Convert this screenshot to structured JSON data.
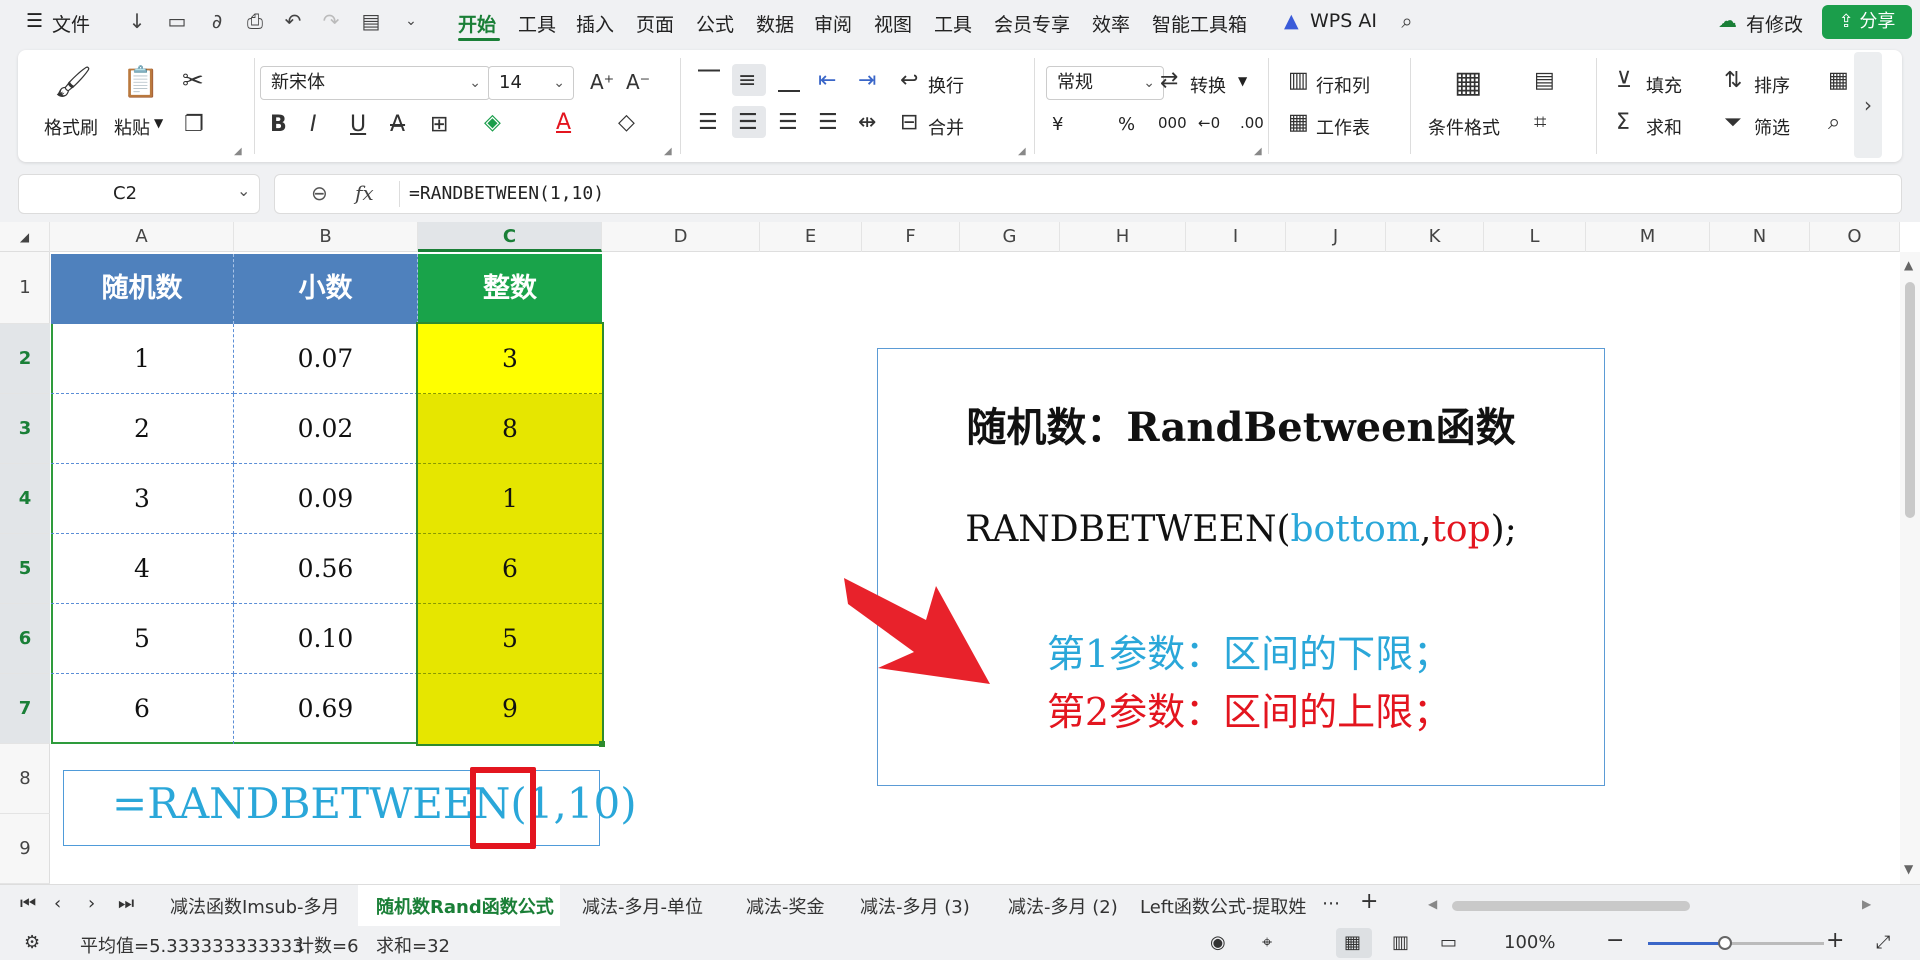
{
  "menubar": {
    "file": "文件",
    "tabs": [
      "开始",
      "工具",
      "插入",
      "页面",
      "公式",
      "数据",
      "审阅",
      "视图",
      "工具",
      "会员专享",
      "效率",
      "智能工具箱"
    ],
    "wps_ai": "WPS AI",
    "status_saved": "有修改",
    "share": "分享"
  },
  "ribbon": {
    "format_painter": "格式刷",
    "paste": "粘贴",
    "font_name": "新宋体",
    "font_size": "14",
    "wrap": "换行",
    "merge": "合并",
    "number_format": "常规",
    "convert": "转换",
    "rows_cols": "行和列",
    "worksheet": "工作表",
    "cond_format": "条件格式",
    "fill": "填充",
    "sort": "排序",
    "sum": "求和",
    "filter": "筛选",
    "yen": "¥",
    "percent": "%",
    "thousands": "000",
    "dec_inc": "←0",
    "dec_dec": ".00"
  },
  "formula_bar": {
    "cell_ref": "C2",
    "fx": "fx",
    "formula": "=RANDBETWEEN(1,10)"
  },
  "columns": [
    "A",
    "B",
    "C",
    "D",
    "E",
    "F",
    "G",
    "H",
    "I",
    "J",
    "K",
    "L",
    "M",
    "N",
    "O"
  ],
  "rows": [
    "1",
    "2",
    "3",
    "4",
    "5",
    "6",
    "7",
    "8",
    "9"
  ],
  "table": {
    "headers": [
      "随机数",
      "小数",
      "整数"
    ],
    "rows": [
      [
        "1",
        "0.07",
        "3"
      ],
      [
        "2",
        "0.02",
        "8"
      ],
      [
        "3",
        "0.09",
        "1"
      ],
      [
        "4",
        "0.56",
        "6"
      ],
      [
        "5",
        "0.10",
        "5"
      ],
      [
        "6",
        "0.69",
        "9"
      ]
    ]
  },
  "textbox": {
    "title": "随机数：RandBetween函数",
    "syntax_fn": "RANDBETWEEN(",
    "syntax_bottom": "bottom",
    "syntax_comma": ",",
    "syntax_top": "top",
    "syntax_end": ");",
    "param1": "第1参数：区间的下限；",
    "param2": "第2参数：区间的上限；"
  },
  "formula_box": {
    "text": "=RANDBETWEEN(1,10)"
  },
  "sheet_tabs": [
    "减法函数Imsub-多月",
    "随机数Rand函数公式",
    "减法-多月-单位",
    "减法-奖金",
    "减法-多月 (3)",
    "减法-多月 (2)",
    "Left函数公式-提取姓"
  ],
  "status": {
    "average": "平均值=5.333333333333",
    "count": "计数=6",
    "sum": "求和=32",
    "zoom": "100%"
  },
  "colors": {
    "accent": "#1a7f37",
    "header_blue": "#4f81bd",
    "header_green": "#19a34a",
    "yellow": "#e6e600",
    "param1": "#2aa7d9",
    "param2": "#e3151f"
  }
}
